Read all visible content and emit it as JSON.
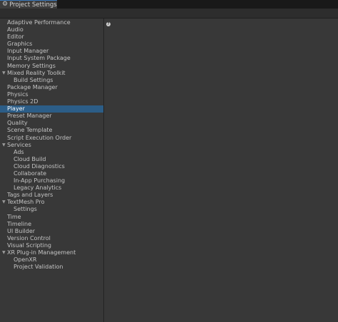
{
  "window": {
    "tab_title": "Project Settings"
  },
  "sidebar": {
    "items": [
      {
        "label": "Adaptive Performance",
        "level": 0
      },
      {
        "label": "Audio",
        "level": 0
      },
      {
        "label": "Editor",
        "level": 0
      },
      {
        "label": "Graphics",
        "level": 0
      },
      {
        "label": "Input Manager",
        "level": 0
      },
      {
        "label": "Input System Package",
        "level": 0
      },
      {
        "label": "Memory Settings",
        "level": 0
      },
      {
        "label": "Mixed Reality Toolkit",
        "level": 0,
        "expanded": true
      },
      {
        "label": "Build Settings",
        "level": 1
      },
      {
        "label": "Package Manager",
        "level": 0
      },
      {
        "label": "Physics",
        "level": 0
      },
      {
        "label": "Physics 2D",
        "level": 0
      },
      {
        "label": "Player",
        "level": 0,
        "selected": true
      },
      {
        "label": "Preset Manager",
        "level": 0
      },
      {
        "label": "Quality",
        "level": 0
      },
      {
        "label": "Scene Template",
        "level": 0
      },
      {
        "label": "Script Execution Order",
        "level": 0
      },
      {
        "label": "Services",
        "level": 0,
        "expanded": true
      },
      {
        "label": "Ads",
        "level": 1
      },
      {
        "label": "Cloud Build",
        "level": 1
      },
      {
        "label": "Cloud Diagnostics",
        "level": 1
      },
      {
        "label": "Collaborate",
        "level": 1
      },
      {
        "label": "In-App Purchasing",
        "level": 1
      },
      {
        "label": "Legacy Analytics",
        "level": 1
      },
      {
        "label": "Tags and Layers",
        "level": 0
      },
      {
        "label": "TextMesh Pro",
        "level": 0,
        "expanded": true
      },
      {
        "label": "Settings",
        "level": 1
      },
      {
        "label": "Time",
        "level": 0
      },
      {
        "label": "Timeline",
        "level": 0
      },
      {
        "label": "UI Builder",
        "level": 0
      },
      {
        "label": "Version Control",
        "level": 0
      },
      {
        "label": "Visual Scripting",
        "level": 0
      },
      {
        "label": "XR Plug-in Management",
        "level": 0,
        "expanded": true
      },
      {
        "label": "OpenXR",
        "level": 1
      },
      {
        "label": "Project Validation",
        "level": 1
      }
    ]
  },
  "content": {
    "help_icon": "help-icon"
  },
  "colors": {
    "selection": "#2c5d87",
    "background": "#383838",
    "tab_accent": "#3a79bb"
  }
}
